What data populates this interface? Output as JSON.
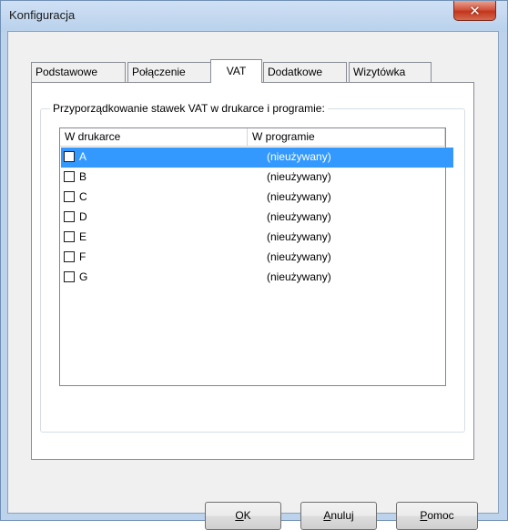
{
  "window": {
    "title": "Konfiguracja",
    "close_glyph": "✕"
  },
  "tabs": [
    {
      "label": "Podstawowe",
      "active": false
    },
    {
      "label": "Połączenie",
      "active": false
    },
    {
      "label": "VAT",
      "active": true
    },
    {
      "label": "Dodatkowe",
      "active": false
    },
    {
      "label": "Wizytówka",
      "active": false
    }
  ],
  "group": {
    "legend": "Przyporządkowanie stawek VAT w drukarce i programie:"
  },
  "list": {
    "columns": [
      "W drukarce",
      "W programie"
    ],
    "rows": [
      {
        "key": "A",
        "value": "(nieużywany)",
        "checked": false,
        "selected": true
      },
      {
        "key": "B",
        "value": "(nieużywany)",
        "checked": false,
        "selected": false
      },
      {
        "key": "C",
        "value": "(nieużywany)",
        "checked": false,
        "selected": false
      },
      {
        "key": "D",
        "value": "(nieużywany)",
        "checked": false,
        "selected": false
      },
      {
        "key": "E",
        "value": "(nieużywany)",
        "checked": false,
        "selected": false
      },
      {
        "key": "F",
        "value": "(nieużywany)",
        "checked": false,
        "selected": false
      },
      {
        "key": "G",
        "value": "(nieużywany)",
        "checked": false,
        "selected": false
      }
    ]
  },
  "buttons": {
    "ok": {
      "mnemonic": "O",
      "rest": "K"
    },
    "cancel": {
      "mnemonic": "A",
      "rest": "nuluj"
    },
    "help": {
      "mnemonic": "P",
      "rest": "omoc"
    }
  },
  "colors": {
    "selection": "#3399ff",
    "close_button": "#c2351c",
    "frame": "#bdd3ec"
  }
}
